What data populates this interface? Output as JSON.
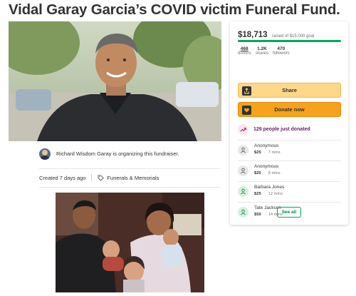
{
  "page": {
    "title": "Vidal Garay Garcia’s COVID victim Funeral Fund."
  },
  "organizer": {
    "text": "Richard Wisdom Garay is organizing this fundraiser."
  },
  "meta": {
    "created": "Created 7 days ago",
    "category": "Funerals & Memorials"
  },
  "campaign": {
    "amount_raised": "$18,713",
    "goal_text": "raised of $15,000 goal",
    "progress_fraction": 1.0,
    "stats": [
      {
        "value": "468",
        "label": "donors"
      },
      {
        "value": "1.2K",
        "label": "shares"
      },
      {
        "value": "470",
        "label": "followers"
      }
    ],
    "share_label": "Share",
    "donate_label": "Donate now",
    "trending_text": "129 people just donated",
    "donations": [
      {
        "name": "Anonymous",
        "amount": "$25",
        "time": "7 mins",
        "avatar": "gray"
      },
      {
        "name": "Anonymous",
        "amount": "$25",
        "time": "8 mins",
        "avatar": "gray"
      },
      {
        "name": "Barbara Jones",
        "amount": "$25",
        "time": "12 mins",
        "avatar": "green"
      },
      {
        "name": "Tate Jackson",
        "amount": "$50",
        "time": "14 mins",
        "avatar": "green"
      }
    ],
    "see_all_label": "See all"
  },
  "colors": {
    "brand_green": "#02a95c",
    "share_button": "#fdd88a",
    "donate_button": "#f7a21c",
    "trend_text": "#6a1b6a"
  },
  "icons": {
    "share": "share-icon",
    "donate": "donate-heart-icon",
    "trending": "trending-up-icon",
    "donor": "donor-avatar-icon",
    "category": "tag-icon"
  }
}
